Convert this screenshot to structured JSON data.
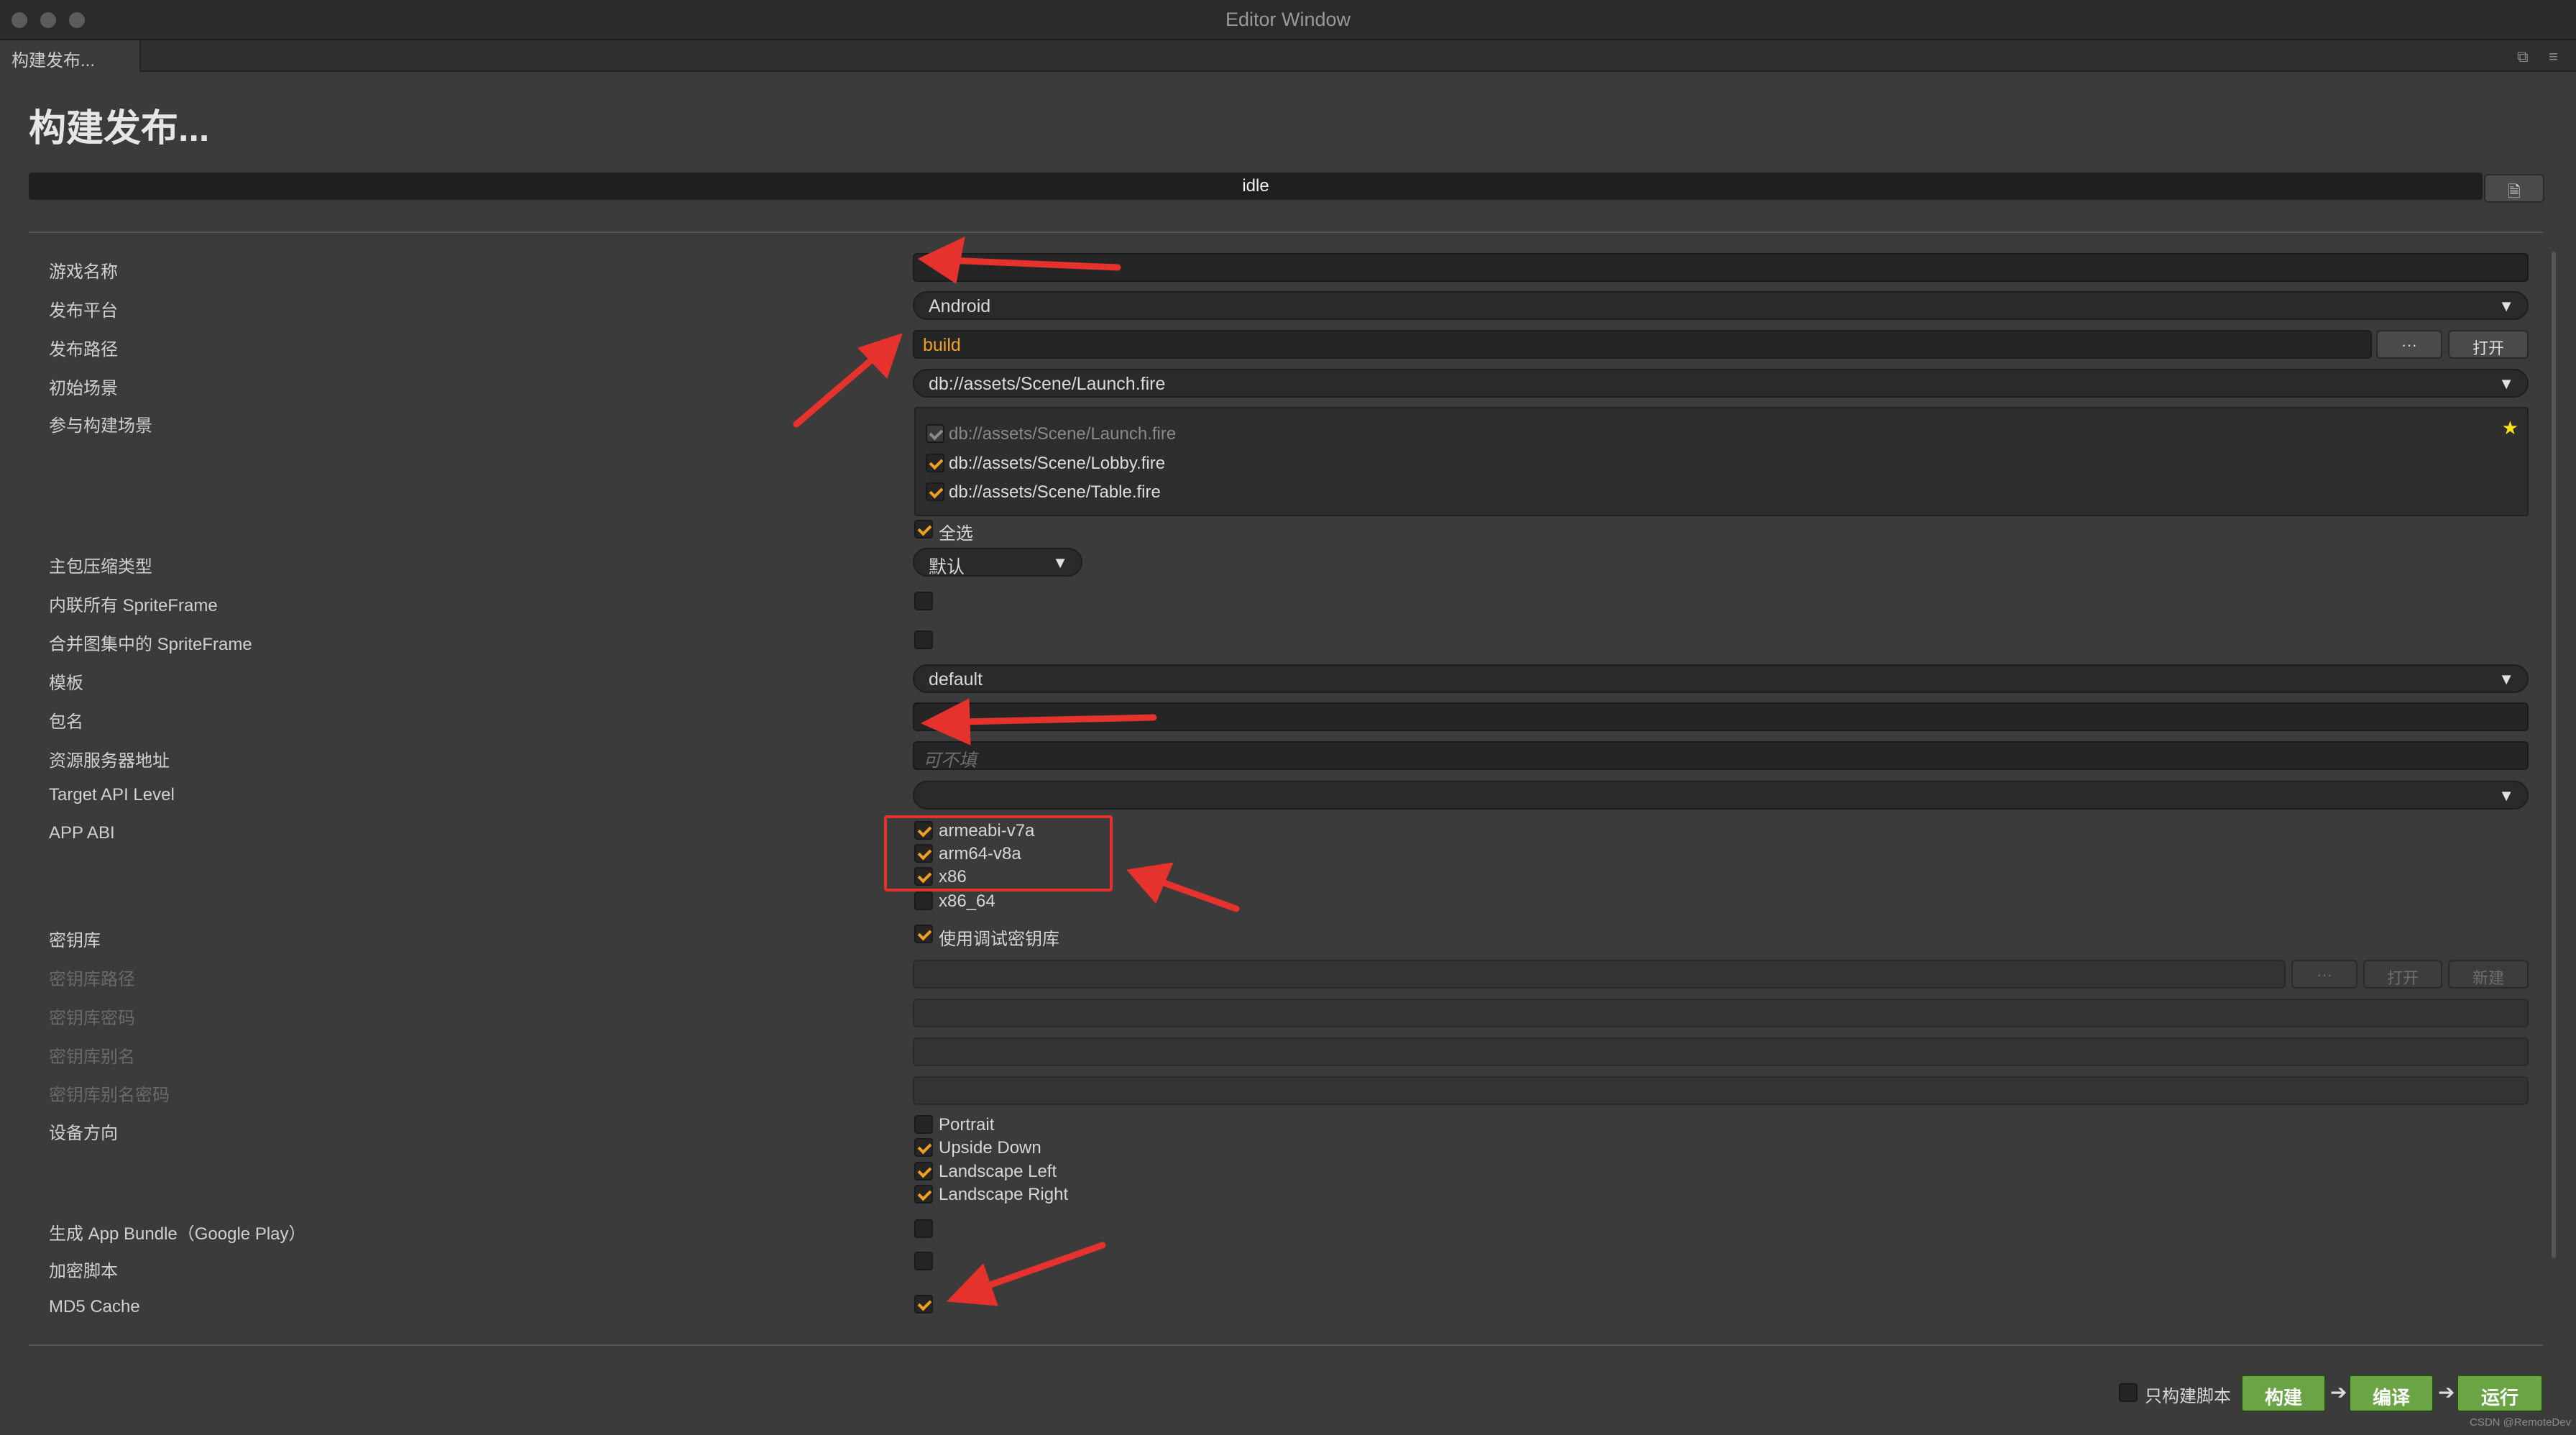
{
  "window": {
    "title": "Editor Window"
  },
  "tab": {
    "label": "构建发布..."
  },
  "header": {
    "title": "构建发布...",
    "status": "idle"
  },
  "form": {
    "game_name": {
      "label": "游戏名称",
      "value": ""
    },
    "platform": {
      "label": "发布平台",
      "value": "Android"
    },
    "build_path": {
      "label": "发布路径",
      "value": "build",
      "browse_label": "···",
      "open_label": "打开"
    },
    "start_scene": {
      "label": "初始场景",
      "value": "db://assets/Scene/Launch.fire"
    },
    "scenes": {
      "label": "参与构建场景",
      "items": [
        {
          "path": "db://assets/Scene/Launch.fire",
          "checked": true,
          "disabled": true
        },
        {
          "path": "db://assets/Scene/Lobby.fire",
          "checked": true,
          "disabled": false
        },
        {
          "path": "db://assets/Scene/Table.fire",
          "checked": true,
          "disabled": false
        }
      ],
      "select_all": "全选"
    },
    "compression": {
      "label": "主包压缩类型",
      "value": "默认"
    },
    "inline_spriteframe": {
      "label": "内联所有 SpriteFrame",
      "checked": false
    },
    "merge_spriteframe": {
      "label": "合并图集中的 SpriteFrame",
      "checked": false
    },
    "template": {
      "label": "模板",
      "value": "default"
    },
    "package_name": {
      "label": "包名",
      "value": ""
    },
    "resource_server": {
      "label": "资源服务器地址",
      "placeholder": "可不填"
    },
    "target_api": {
      "label": "Target API Level",
      "value": ""
    },
    "app_abi": {
      "label": "APP ABI",
      "options": [
        {
          "name": "armeabi-v7a",
          "checked": true
        },
        {
          "name": "arm64-v8a",
          "checked": true
        },
        {
          "name": "x86",
          "checked": true
        },
        {
          "name": "x86_64",
          "checked": false
        }
      ]
    },
    "keystore": {
      "label": "密钥库",
      "use_debug_label": "使用调试密钥库",
      "use_debug": true
    },
    "keystore_path": {
      "label": "密钥库路径",
      "browse_label": "···",
      "open_label": "打开",
      "new_label": "新建"
    },
    "keystore_password": {
      "label": "密钥库密码"
    },
    "keystore_alias": {
      "label": "密钥库别名"
    },
    "keystore_alias_password": {
      "label": "密钥库别名密码"
    },
    "orientation": {
      "label": "设备方向",
      "options": [
        {
          "name": "Portrait",
          "checked": false
        },
        {
          "name": "Upside Down",
          "checked": true
        },
        {
          "name": "Landscape Left",
          "checked": true
        },
        {
          "name": "Landscape Right",
          "checked": true
        }
      ]
    },
    "app_bundle": {
      "label": "生成 App Bundle（Google Play）",
      "checked": false
    },
    "encrypt_script": {
      "label": "加密脚本",
      "checked": false
    },
    "md5_cache": {
      "label": "MD5 Cache",
      "checked": true
    }
  },
  "footer": {
    "only_script_label": "只构建脚本",
    "build_label": "构建",
    "compile_label": "编译",
    "run_label": "运行",
    "watermark": "CSDN @RemoteDev"
  },
  "colors": {
    "accent_check": "#f0a020",
    "action_green": "#6aa444",
    "annotation_red": "#e5322d",
    "path_orange": "#f0a020"
  }
}
